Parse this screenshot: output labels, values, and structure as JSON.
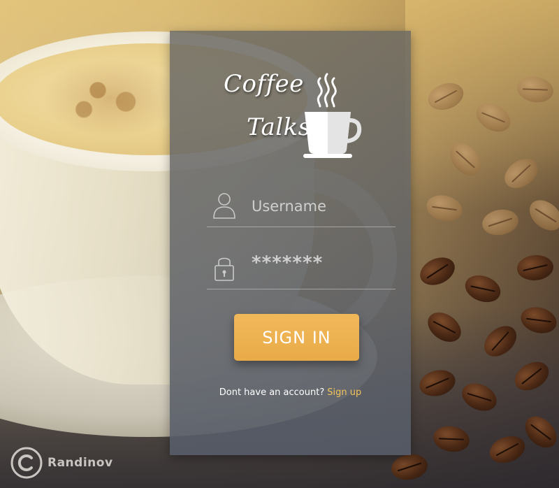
{
  "logo": {
    "line1": "Coffee",
    "line2": "Talks",
    "icon": "coffee-cup-icon"
  },
  "form": {
    "username": {
      "placeholder": "Username",
      "icon": "user-icon"
    },
    "password": {
      "value": "*******",
      "icon": "lock-icon"
    },
    "signin_label": "SIGN IN",
    "account_prompt": "Dont have an account?",
    "signup_label": "Sign up"
  },
  "watermark": {
    "icon": "copyright-icon",
    "text": "Randinov"
  },
  "colors": {
    "accent": "#f1b85a",
    "link": "#f3c45b",
    "text": "#ffffff"
  }
}
